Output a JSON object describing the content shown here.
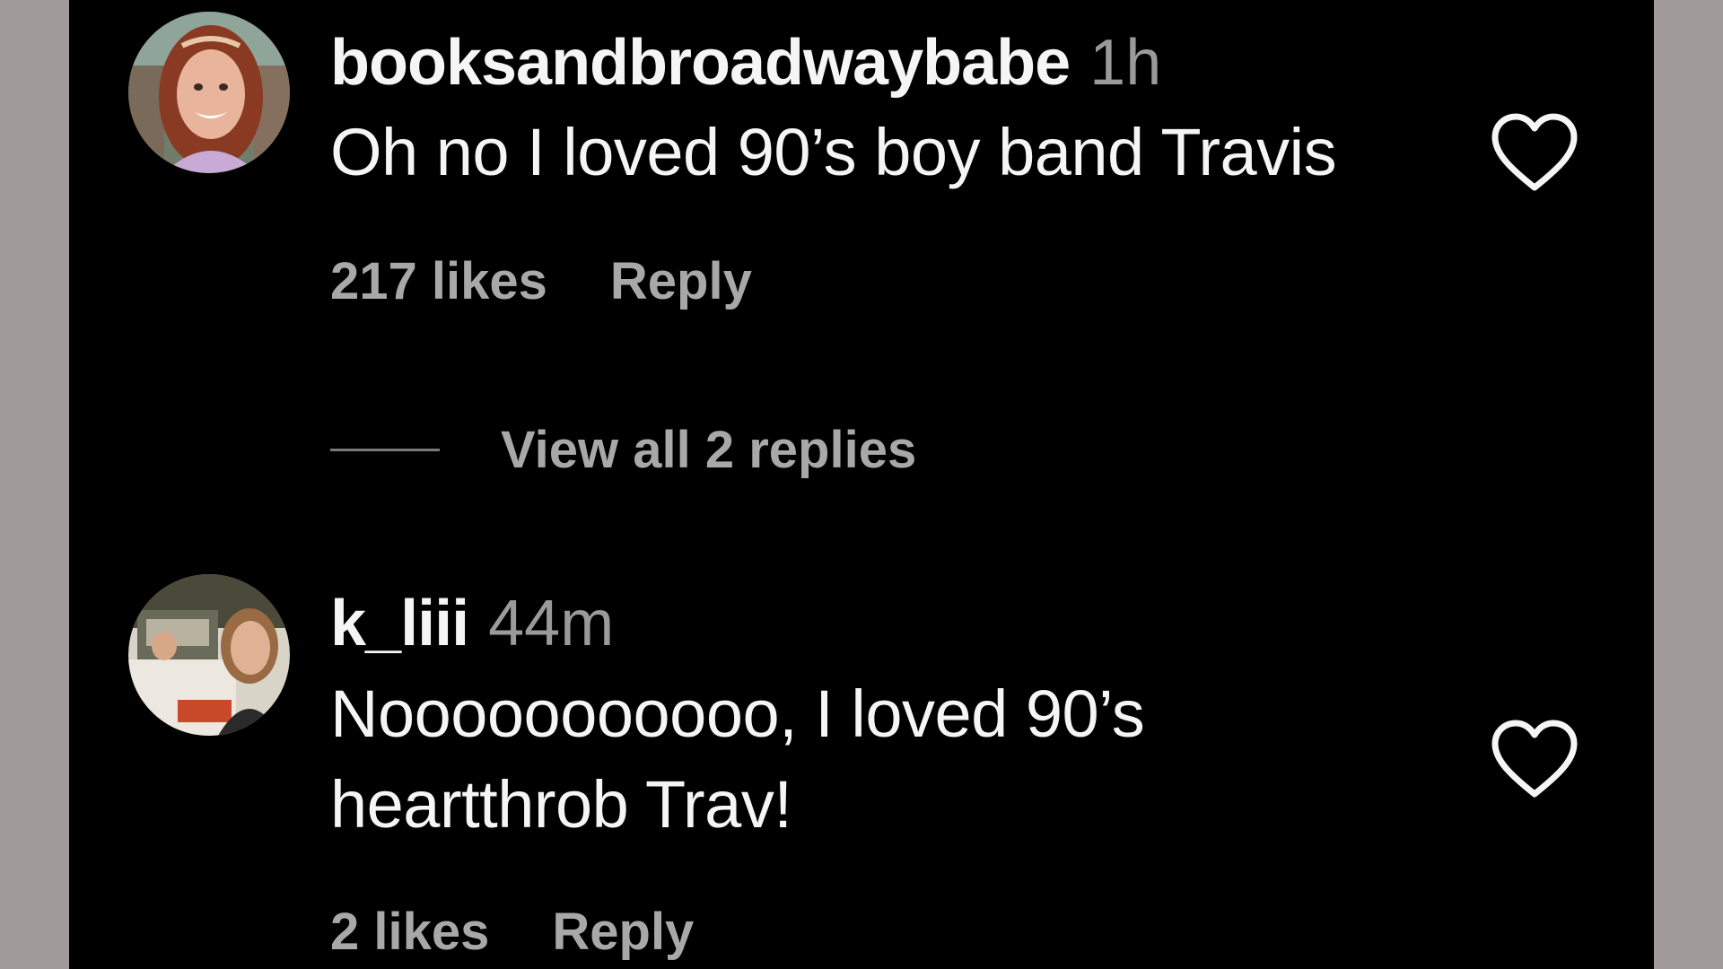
{
  "comments": [
    {
      "username": "booksandbroadwaybabe",
      "time": "1h",
      "text_lines": [
        "Oh no I loved 90’s boy band Travis"
      ],
      "likes": "217 likes",
      "reply_label": "Reply",
      "like_icon": "heart-outline-icon",
      "view_replies": "View all 2 replies"
    },
    {
      "username": "k_liii",
      "time": "44m",
      "text_lines": [
        "Nooooooooooo, I loved 90’s",
        "heartthrob Trav!"
      ],
      "likes": "2 likes",
      "reply_label": "Reply",
      "like_icon": "heart-outline-icon"
    }
  ],
  "colors": {
    "background": "#000000",
    "frame": "#a09b9a",
    "primary_text": "#f5f5f5",
    "secondary_text": "#a8a8a8"
  }
}
